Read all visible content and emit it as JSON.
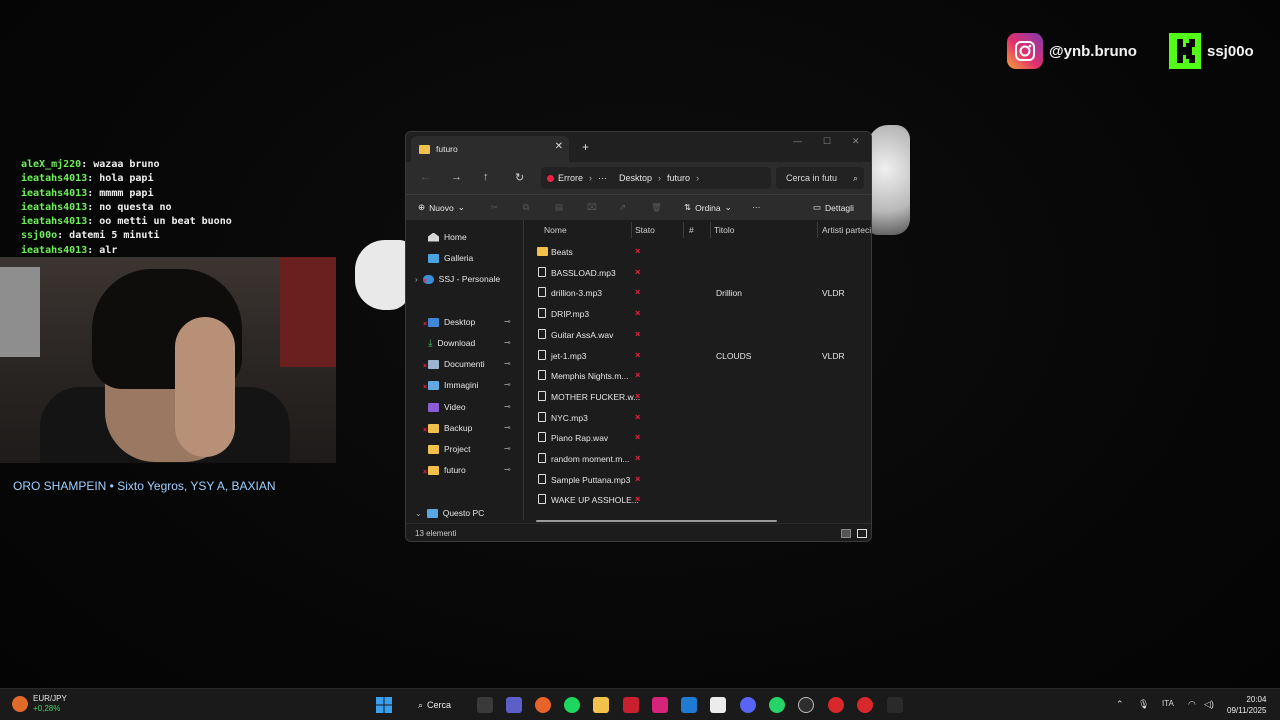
{
  "overlay": {
    "instagram_handle": "@ynb.bruno",
    "kick_handle": "ssj00o",
    "now_playing": "ORO SHAMPEIN • Sixto Yegros, YSY A, BAXIAN"
  },
  "chat": [
    {
      "user": "aleX_mj220",
      "msg": "wazaa bruno"
    },
    {
      "user": "ieatahs4013",
      "msg": "hola papi"
    },
    {
      "user": "ieatahs4013",
      "msg": "mmmm papi"
    },
    {
      "user": "ieatahs4013",
      "msg": "no questa no"
    },
    {
      "user": "ieatahs4013",
      "msg": "oo metti un beat buono"
    },
    {
      "user": "ssj00o",
      "msg": "datemi 5 minuti"
    },
    {
      "user": "ieatahs4013",
      "msg": "alr"
    }
  ],
  "explorer": {
    "tab_title": "futuro",
    "new_tab": "+",
    "breadcrumb": {
      "error": "Errore",
      "more": "···",
      "desktop": "Desktop",
      "current": "futuro"
    },
    "search_placeholder": "Cerca in futu",
    "toolbar": {
      "new": "Nuovo",
      "sort": "Ordina",
      "more": "···",
      "details": "Dettagli"
    },
    "columns": {
      "name": "Nome",
      "status": "Stato",
      "number": "#",
      "title": "Titolo",
      "artists": "Artisti partecip"
    },
    "sidebar": {
      "home": "Home",
      "gallery": "Galleria",
      "onedrive": "SSJ - Personale",
      "desktop": "Desktop",
      "downloads": "Download",
      "documents": "Documenti",
      "pictures": "Immagini",
      "videos": "Video",
      "backup": "Backup",
      "project": "Project",
      "futuro": "futuro",
      "this_pc": "Questo PC"
    },
    "files": [
      {
        "name": "Beats",
        "type": "folder",
        "title": "",
        "artist": ""
      },
      {
        "name": "BASSLOAD.mp3",
        "type": "file",
        "title": "",
        "artist": ""
      },
      {
        "name": "drillion-3.mp3",
        "type": "file",
        "title": "Drillion",
        "artist": "VLDR"
      },
      {
        "name": "DRIP.mp3",
        "type": "file",
        "title": "",
        "artist": ""
      },
      {
        "name": "Guitar AssA.wav",
        "type": "file",
        "title": "",
        "artist": ""
      },
      {
        "name": "jet-1.mp3",
        "type": "file",
        "title": "CLOUDS",
        "artist": "VLDR"
      },
      {
        "name": "Memphis Nights.m...",
        "type": "file",
        "title": "",
        "artist": ""
      },
      {
        "name": "MOTHER FUCKER.w...",
        "type": "file",
        "title": "",
        "artist": ""
      },
      {
        "name": "NYC.mp3",
        "type": "file",
        "title": "",
        "artist": ""
      },
      {
        "name": "Piano Rap.wav",
        "type": "file",
        "title": "",
        "artist": ""
      },
      {
        "name": "random moment.m...",
        "type": "file",
        "title": "",
        "artist": ""
      },
      {
        "name": "Sample Puttana.mp3",
        "type": "file",
        "title": "",
        "artist": ""
      },
      {
        "name": "WAKE UP ASSHOLE...",
        "type": "file",
        "title": "",
        "artist": ""
      }
    ],
    "status_x": "×",
    "item_count": "13 elementi"
  },
  "taskbar": {
    "ticker_name": "EUR/JPY",
    "ticker_change": "+0,28%",
    "search_label": "Cerca",
    "language": "ITA",
    "time": "20:04",
    "date": "09/11/2025"
  },
  "colors": {
    "accent_error": "#e22244",
    "chat_user": "#6ef05a",
    "kick": "#53fc18",
    "folder": "#f2c14b"
  }
}
